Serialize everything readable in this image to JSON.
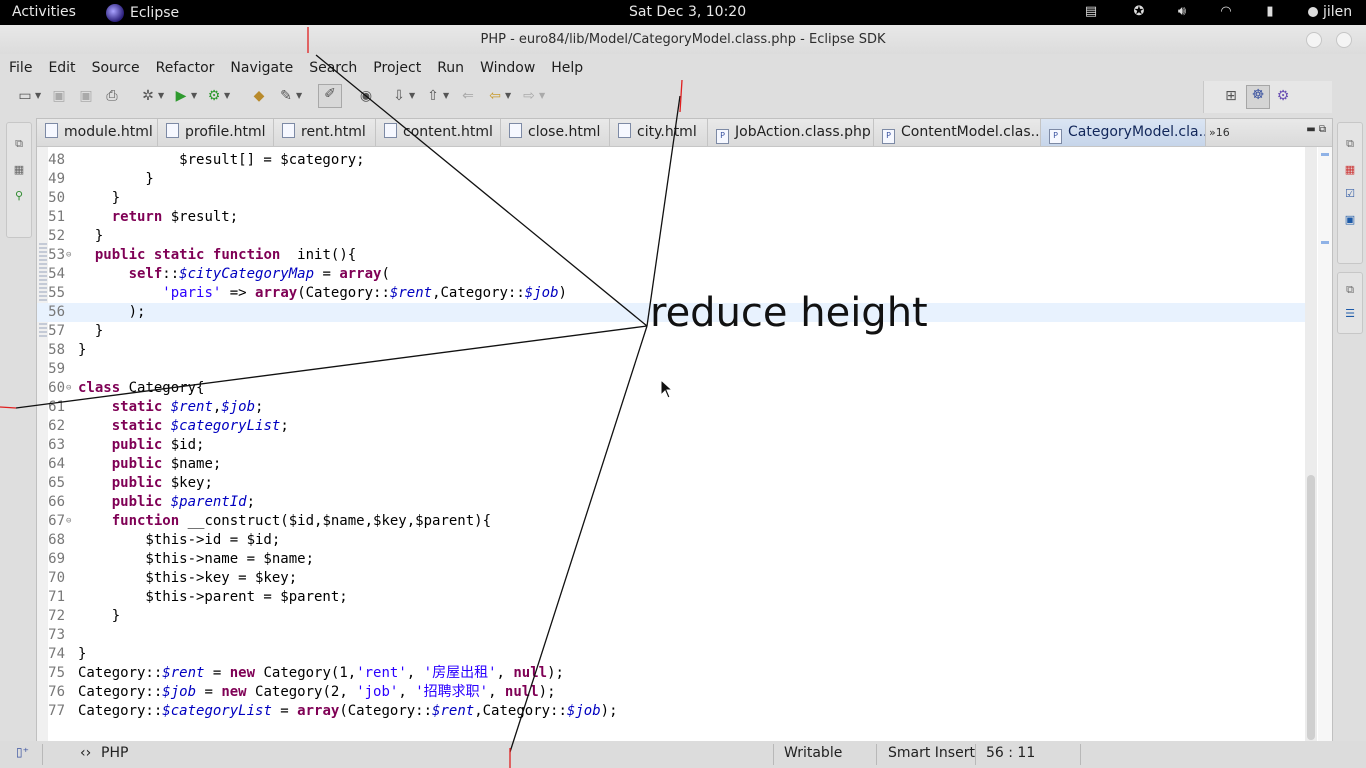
{
  "topbar": {
    "activities": "Activities",
    "app_name": "Eclipse",
    "clock": "Sat Dec  3, 10:20",
    "user": "jilen"
  },
  "window": {
    "title": "PHP - euro84/lib/Model/CategoryModel.class.php - Eclipse SDK"
  },
  "menu": [
    "File",
    "Edit",
    "Source",
    "Refactor",
    "Navigate",
    "Search",
    "Project",
    "Run",
    "Window",
    "Help"
  ],
  "tabs": [
    {
      "label": "module.html"
    },
    {
      "label": "profile.html"
    },
    {
      "label": "rent.html"
    },
    {
      "label": "content.html"
    },
    {
      "label": "close.html"
    },
    {
      "label": "city.html"
    },
    {
      "label": "JobAction.class.php"
    },
    {
      "label": "ContentModel.clas..."
    },
    {
      "label": "CategoryModel.cla..."
    }
  ],
  "tab_overflow": "»16",
  "code_lines": [
    {
      "n": "48",
      "t": "            $result[] = $category;"
    },
    {
      "n": "49",
      "t": "        }"
    },
    {
      "n": "50",
      "t": "    }"
    },
    {
      "n": "51",
      "t": "    return $result;"
    },
    {
      "n": "52",
      "t": "  }"
    },
    {
      "n": "53",
      "t": "  public static function  init(){"
    },
    {
      "n": "54",
      "t": "      self::$cityCategoryMap = array("
    },
    {
      "n": "55",
      "t": "          'paris' => array(Category::$rent,Category::$job)"
    },
    {
      "n": "56",
      "t": "      );"
    },
    {
      "n": "57",
      "t": "  }"
    },
    {
      "n": "58",
      "t": "}"
    },
    {
      "n": "59",
      "t": ""
    },
    {
      "n": "60",
      "t": "class Category{"
    },
    {
      "n": "61",
      "t": "    static $rent,$job;"
    },
    {
      "n": "62",
      "t": "    static $categoryList;"
    },
    {
      "n": "63",
      "t": "    public $id;"
    },
    {
      "n": "64",
      "t": "    public $name;"
    },
    {
      "n": "65",
      "t": "    public $key;"
    },
    {
      "n": "66",
      "t": "    public $parentId;"
    },
    {
      "n": "67",
      "t": "    function __construct($id,$name,$key,$parent){"
    },
    {
      "n": "68",
      "t": "        $this->id = $id;"
    },
    {
      "n": "69",
      "t": "        $this->name = $name;"
    },
    {
      "n": "70",
      "t": "        $this->key = $key;"
    },
    {
      "n": "71",
      "t": "        $this->parent = $parent;"
    },
    {
      "n": "72",
      "t": "    }"
    },
    {
      "n": "73",
      "t": ""
    },
    {
      "n": "74",
      "t": "}"
    },
    {
      "n": "75",
      "t": "Category::$rent = new Category(1,'rent', '房屋出租', null);"
    },
    {
      "n": "76",
      "t": "Category::$job = new Category(2, 'job', '招聘求职', null);"
    },
    {
      "n": "77",
      "t": "Category::$categoryList = array(Category::$rent,Category::$job);"
    }
  ],
  "status": {
    "language": "PHP",
    "writable": "Writable",
    "insert_mode": "Smart Insert",
    "position": "56 : 11"
  },
  "annotation": "reduce height"
}
